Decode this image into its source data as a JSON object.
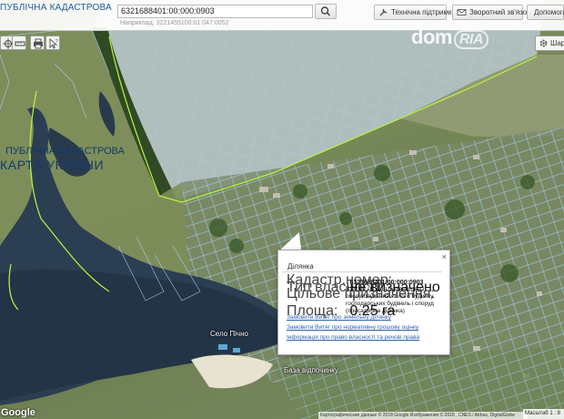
{
  "header": {
    "brand_top": "ПУБЛІЧНА КАДАСТРОВА",
    "search_value": "6321688401:00:000:0903",
    "search_hint": "Наприклад: 3221455100:01:047:0052",
    "support_label": "Технічна підтримка",
    "feedback_label": "Зворотний зв'язок",
    "help_label": "Допомога"
  },
  "title": {
    "line1": "ПУБЛІЧНА КАДАСТРОВА",
    "line2": "КАРТА УКРАЇНИ"
  },
  "layers_label": "Шари",
  "watermark": {
    "main": "dom",
    "sub": "RIA"
  },
  "popup": {
    "tab": "Ділянка",
    "close": "×",
    "cadastral_label": "Кадастр.номер:",
    "cadastral_value": "6321688401:00:000:0903",
    "ownership_label": "Тип власності:",
    "ownership_value": "не визначено",
    "purpose_label": "Цільове призначення:",
    "purpose_value": "В 02.02.01 Для будівництва і обслуговування жилого будинку, господарських будівель і споруд (присадибна ділянка)",
    "area_label": "Площа:",
    "area_value": "0.25 га",
    "link1": "Замовити Витяг про земельну ділянку",
    "link2": "Замовити Витяг про нормативну грошову оцінку",
    "link3": "Інформація про право власності та речові права"
  },
  "places": {
    "p1": "Село Пічно",
    "p2": "База відпочинку"
  },
  "footer": {
    "google": "Google",
    "copyright": "Картографические данные © 2018 Google Изображения © 2018 , CNES / Airbus, DigitalGlobe",
    "scale": "Масштаб 1 : 8"
  },
  "colors": {
    "boundary": "#b9f542",
    "parcel": "#9fd0ff",
    "link": "#2a61b0",
    "brand": "#1b5c9c"
  }
}
